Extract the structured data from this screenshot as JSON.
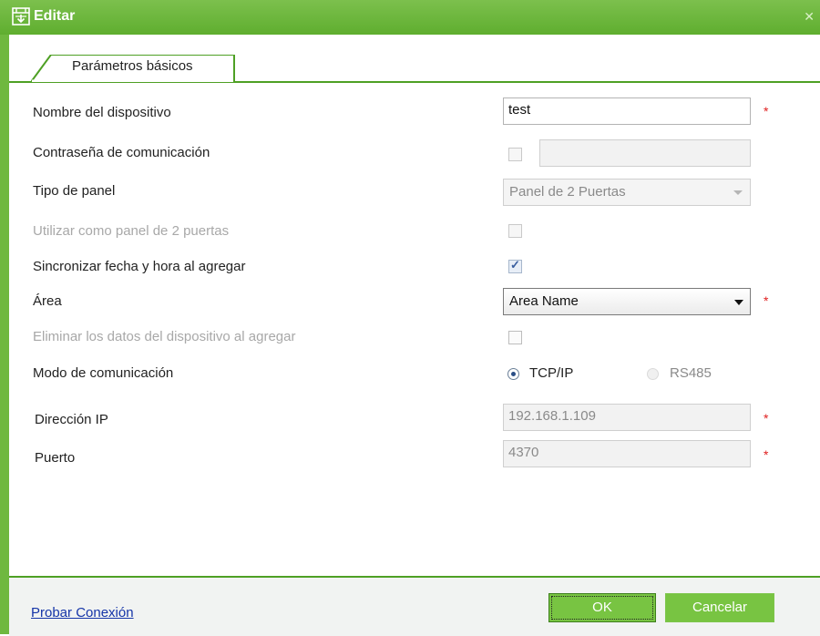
{
  "window": {
    "title": "Editar",
    "close_icon": "close-icon"
  },
  "tabs": [
    {
      "label": "Parámetros básicos",
      "active": true
    }
  ],
  "colors": {
    "accent_green": "#6fb83f",
    "required": "#e02020",
    "link": "#1535a8"
  },
  "form": {
    "device_name": {
      "label": "Nombre del dispositivo",
      "value": "test",
      "required_mark": "*"
    },
    "comm_password": {
      "label": "Contraseña de comunicación",
      "checked": false,
      "value": ""
    },
    "panel_type": {
      "label": "Tipo de panel",
      "value": "Panel de 2 Puertas"
    },
    "use_two_door": {
      "label": "Utilizar como panel de 2 puertas",
      "checked": false
    },
    "sync_time": {
      "label": "Sincronizar fecha y hora al agregar",
      "checked": true
    },
    "area": {
      "label": "Área",
      "value": "Area Name",
      "required_mark": "*"
    },
    "delete_data": {
      "label": "Eliminar los datos del dispositivo al agregar",
      "checked": false
    },
    "comm_mode": {
      "label": "Modo de comunicación",
      "option_tcp": "TCP/IP",
      "option_rs485": "RS485",
      "selected": "TCP/IP"
    },
    "ip_address": {
      "label": "Dirección IP",
      "value": "192.168.1.109",
      "required_mark": "*"
    },
    "port": {
      "label": "Puerto",
      "value": "4370",
      "required_mark": "*"
    }
  },
  "footer": {
    "test_link": "Probar Conexión",
    "ok_label": "OK",
    "cancel_label": "Cancelar"
  }
}
